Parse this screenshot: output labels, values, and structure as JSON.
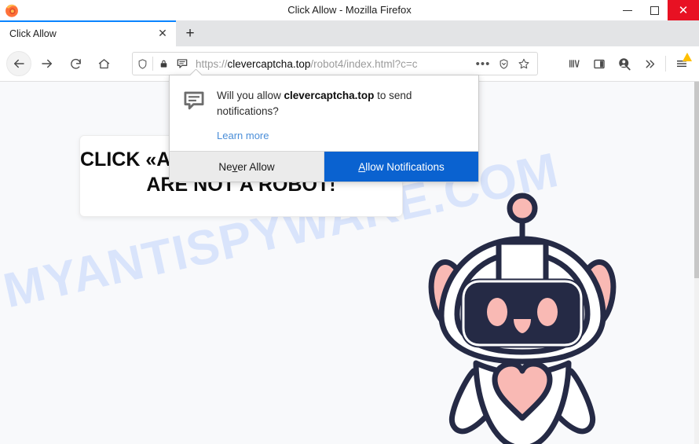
{
  "window": {
    "title": "Click Allow - Mozilla Firefox",
    "minimize_label": "Minimize",
    "maximize_label": "Maximize",
    "close_label": "✕"
  },
  "tabs": {
    "active": {
      "title": "Click Allow",
      "close_label": "✕"
    },
    "new_tab_label": "+"
  },
  "toolbar": {
    "back_label": "Back",
    "forward_label": "Forward",
    "reload_label": "Reload",
    "home_label": "Home",
    "library_label": "Library",
    "sidebar_label": "Sidebar",
    "account_label": "Account",
    "overflow_label": "More tools",
    "menu_label": "Open menu"
  },
  "urlbar": {
    "scheme": "https://",
    "host": "clevercaptcha.top",
    "path": "/robot4/index.html?c=c",
    "full_url": "https://clevercaptcha.top/robot4/index.html?c=c",
    "page_actions_label": "•••",
    "tracking_protection_label": "Tracking Protection",
    "bookmark_label": "Bookmark this page"
  },
  "page": {
    "watermark": "MYANTISPYWARE.COM",
    "card": {
      "line1": "CLICK «ALLOW» TO CONFIRM THAT YOU",
      "line2": "ARE NOT A ROBOT!"
    },
    "robot_alt": "cute robot mascot illustration"
  },
  "notification": {
    "message_prefix": "Will you allow ",
    "message_host": "clevercaptcha.top",
    "message_suffix": " to send notifications?",
    "learn_more": "Learn more",
    "never_allow": "Never Allow",
    "never_allow_before": "Ne",
    "never_allow_key": "v",
    "never_allow_after": "er Allow",
    "allow": "Allow Notifications",
    "allow_key": "A",
    "allow_after": "llow Notifications"
  },
  "colors": {
    "accent_blue": "#0a62d0",
    "tab_active_line": "#0a84ff",
    "close_red": "#e81123",
    "robot_dark": "#252a45",
    "robot_pink": "#f9b9b4",
    "watermark": "#d9e4fb",
    "link_blue": "#4a8ed8"
  }
}
